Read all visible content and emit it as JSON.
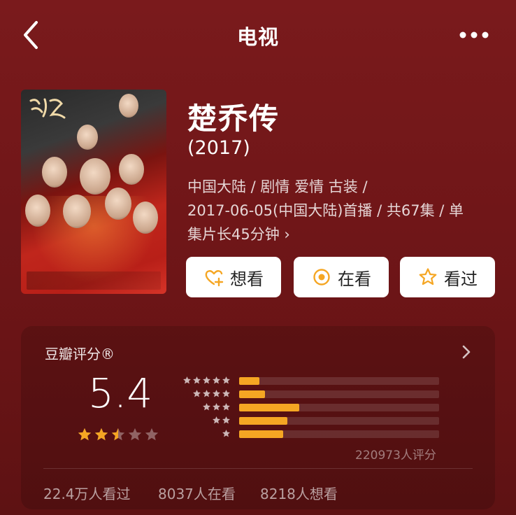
{
  "header": {
    "title": "电视",
    "back_icon": "chevron-left-icon",
    "more_icon": "more-dots-icon"
  },
  "movie": {
    "title": "楚乔传",
    "year": "(2017)",
    "meta_line1": "中国大陆 / 剧情 爱情 古装 /",
    "meta_line2": "2017-06-05(中国大陆)首播 / 共67集 / 单",
    "meta_line3": "集片长45分钟 ›",
    "poster_logo": "楚乔传"
  },
  "actions": [
    {
      "label": "想看",
      "icon": "heart-plus-icon"
    },
    {
      "label": "在看",
      "icon": "target-circle-icon"
    },
    {
      "label": "看过",
      "icon": "star-outline-icon"
    }
  ],
  "rating": {
    "header": "豆瓣评分®",
    "score": "5.4",
    "stars": 2.5,
    "distribution": [
      {
        "stars": 5,
        "fraction": 0.1
      },
      {
        "stars": 4,
        "fraction": 0.13
      },
      {
        "stars": 3,
        "fraction": 0.3
      },
      {
        "stars": 2,
        "fraction": 0.24
      },
      {
        "stars": 1,
        "fraction": 0.22
      }
    ],
    "count": "220973人评分"
  },
  "stats": {
    "watched": "22.4万人看过",
    "watching": "8037人在看",
    "wish": "8218人想看"
  },
  "colors": {
    "background": "#6d1517",
    "accent": "#f5a623",
    "button_bg": "#ffffff"
  }
}
